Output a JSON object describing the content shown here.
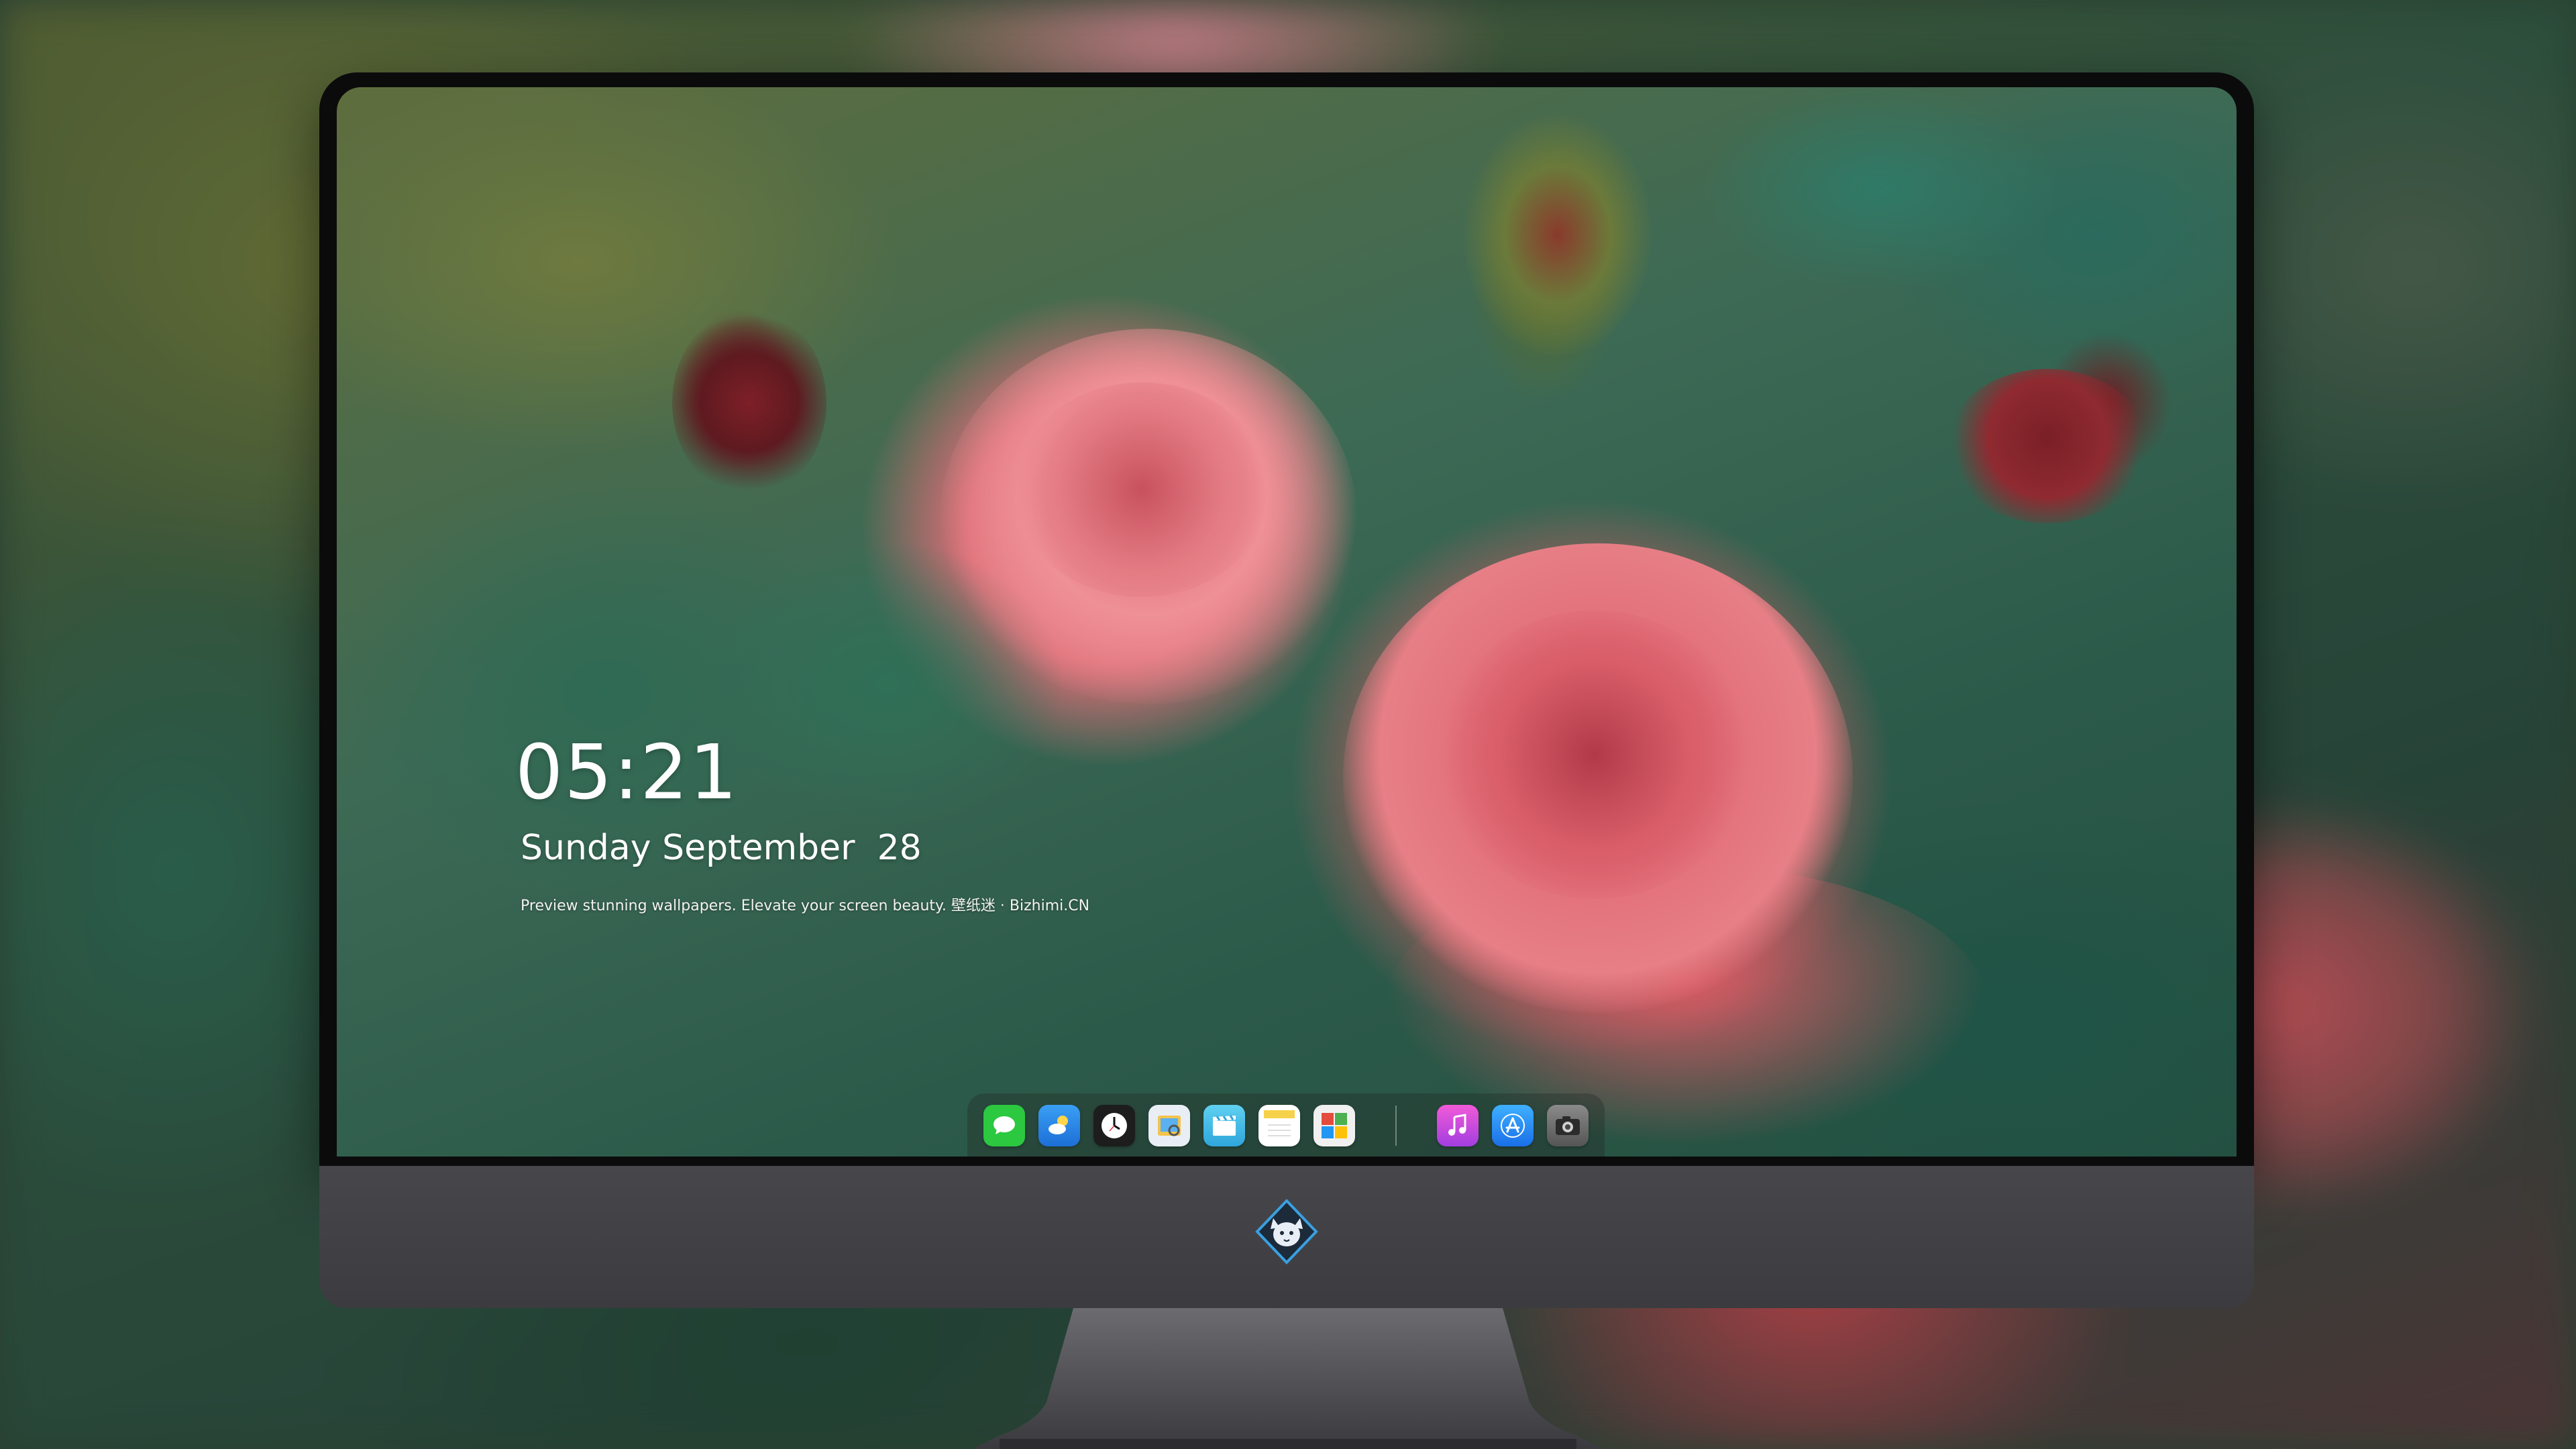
{
  "lockscreen": {
    "time": "05:21",
    "date": "Sunday September  28",
    "tagline": "Preview stunning wallpapers. Elevate your screen beauty. 壁纸迷 · Bizhimi.CN"
  },
  "dock": {
    "left_apps": [
      {
        "name": "messages-icon",
        "color": "#2bc840"
      },
      {
        "name": "weather-icon",
        "color": "#2a7fe0"
      },
      {
        "name": "clock-icon",
        "color": "#1d1d1d"
      },
      {
        "name": "preview-icon",
        "color": "#e8c04a"
      },
      {
        "name": "clips-icon",
        "color": "#49c1e6"
      },
      {
        "name": "notes-icon",
        "color": "#f6d24a"
      },
      {
        "name": "photo-booth-icon",
        "color": "#d84c3c"
      }
    ],
    "right_apps": [
      {
        "name": "music-icon",
        "color": "#cf4bd8"
      },
      {
        "name": "app-store-icon",
        "color": "#1f8cf0"
      },
      {
        "name": "camera-icon",
        "color": "#6e6e6e"
      }
    ]
  },
  "monitor": {
    "bezel_color": "#0b0b0c",
    "chin_color": "#46464a",
    "logo": "fox-mascot-logo"
  }
}
